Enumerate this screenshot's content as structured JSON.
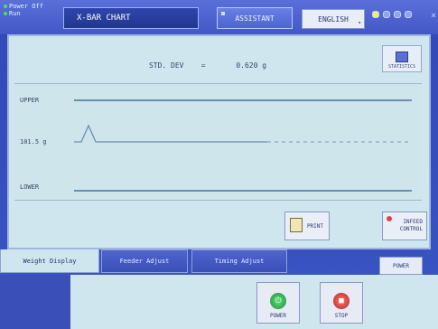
{
  "status": {
    "line1": "Power Off",
    "line2": "Run"
  },
  "header": {
    "title": "X-BAR CHART",
    "assistant_label": "ASSISTANT",
    "language": "ENGLISH"
  },
  "stats": {
    "std_dev_label": "STD. DEV",
    "std_dev_eq": "=",
    "std_dev_value": "0.620 g",
    "statistics_button": "STATISTICS"
  },
  "chart_data": {
    "type": "line",
    "labels": {
      "upper": "UPPER",
      "target": "101.5 g",
      "lower": "LOWER"
    },
    "target": 101.5,
    "series": [
      {
        "values": [
          101.5,
          101.5,
          103.0,
          101.5,
          101.5,
          101.5,
          101.5,
          101.5
        ]
      }
    ]
  },
  "buttons": {
    "print": "PRINT",
    "infeed_line1": "INFEED",
    "infeed_line2": "CONTROL",
    "power_small": "POWER",
    "power": "POWER",
    "stop": "STOP"
  },
  "tabs": [
    {
      "label": "Weight Display",
      "active": true
    },
    {
      "label": "Feeder Adjust",
      "active": false
    },
    {
      "label": "Timing Adjust",
      "active": false
    }
  ],
  "colors": {
    "accent": "#3a4fb8",
    "panel": "#cfe6ee",
    "line": "#6a8fb0"
  }
}
